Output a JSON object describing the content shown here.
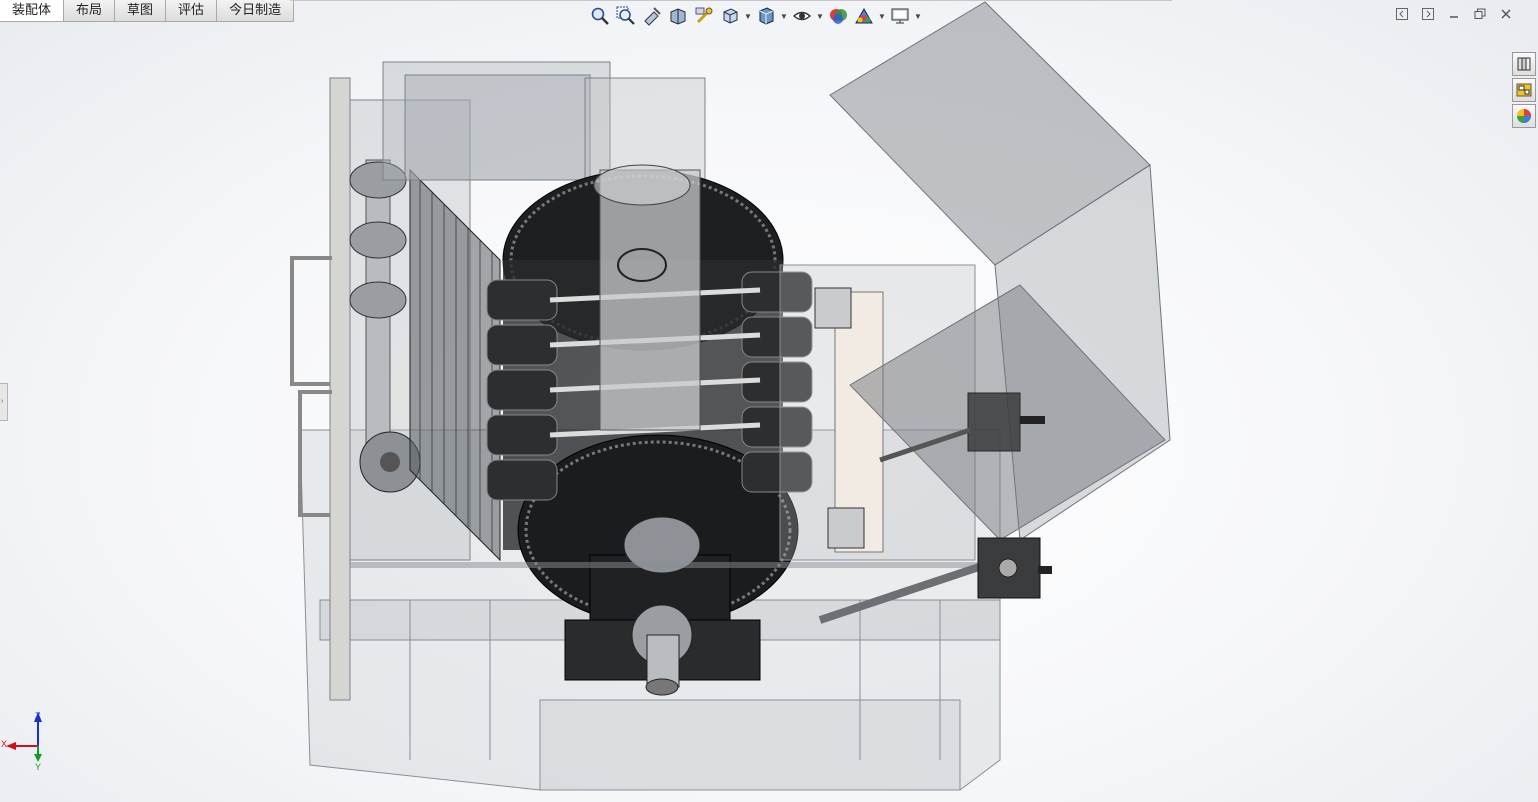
{
  "tabs": [
    {
      "label": "装配体"
    },
    {
      "label": "布局"
    },
    {
      "label": "草图"
    },
    {
      "label": "评估"
    },
    {
      "label": "今日制造"
    }
  ],
  "active_tab": 0,
  "view_toolbar": [
    {
      "icon": "zoom-to-fit-icon"
    },
    {
      "icon": "zoom-to-area-icon"
    },
    {
      "icon": "previous-view-icon"
    },
    {
      "icon": "section-view-icon"
    },
    {
      "icon": "dynamic-annotation-icon"
    },
    {
      "icon": "view-orientation-icon",
      "dropdown": true
    },
    {
      "icon": "display-style-icon",
      "dropdown": true
    },
    {
      "icon": "hide-show-items-icon",
      "dropdown": true
    },
    {
      "icon": "edit-appearance-icon"
    },
    {
      "icon": "apply-scene-icon",
      "dropdown": true
    },
    {
      "icon": "view-settings-icon",
      "dropdown": true
    }
  ],
  "window_controls": [
    {
      "icon": "tile-left-icon"
    },
    {
      "icon": "tile-right-icon"
    },
    {
      "icon": "minimize-icon"
    },
    {
      "icon": "restore-icon"
    },
    {
      "icon": "close-icon"
    }
  ],
  "task_pane": [
    {
      "icon": "design-library-icon"
    },
    {
      "icon": "view-palette-icon"
    },
    {
      "icon": "appearances-icon"
    }
  ],
  "triad": {
    "x_label": "X",
    "y_label": "Y",
    "z_label": "Z"
  },
  "colors": {
    "axis_x": "#d0101a",
    "axis_y": "#159a2c",
    "axis_z": "#1a2fd0",
    "accent": "#f3c21d"
  }
}
